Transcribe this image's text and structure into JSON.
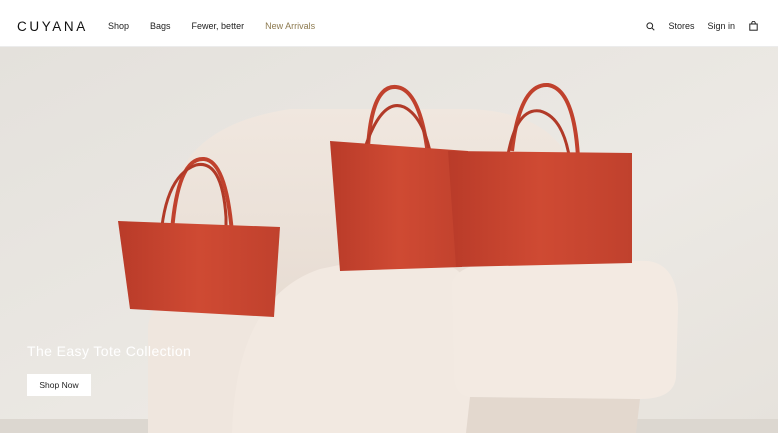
{
  "header": {
    "logo": "CUYANA",
    "nav": [
      {
        "label": "Shop"
      },
      {
        "label": "Bags"
      },
      {
        "label": "Fewer, better"
      },
      {
        "label": "New Arrivals"
      }
    ],
    "stores_label": "Stores",
    "signin_label": "Sign in",
    "icons": {
      "search": "search-icon",
      "bag": "shopping-bag-icon"
    }
  },
  "hero": {
    "title": "The Easy Tote Collection",
    "cta_label": "Shop Now"
  },
  "colors": {
    "accent": "#8d7a4f",
    "bag_red": "#c8432f",
    "chair": "#ede3da",
    "background": "#e9e6e1"
  }
}
